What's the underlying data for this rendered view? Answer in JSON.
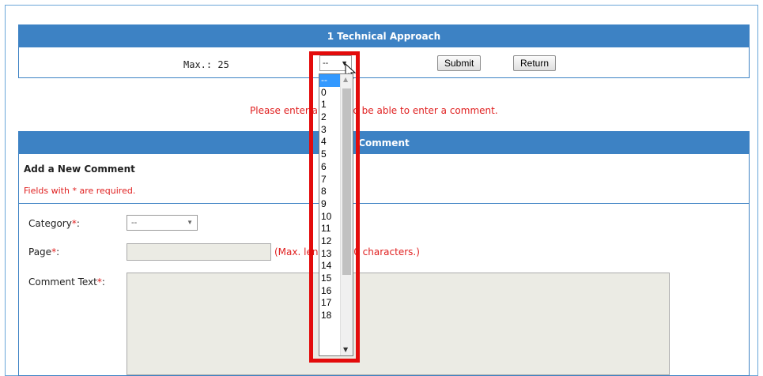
{
  "section": {
    "title": "1 Technical Approach",
    "max_label": "Max.: 25",
    "select_value": "--",
    "submit_label": "Submit",
    "return_label": "Return"
  },
  "message": {
    "text": "Please enter a score to be able to enter a comment."
  },
  "comment": {
    "header": "Comment",
    "title": "Add a New Comment",
    "required_note": "Fields with * are required.",
    "category_label": "Category",
    "category_value": "--",
    "page_label": "Page",
    "page_hint": "(Max. length is 50 characters.)",
    "text_label": "Comment Text",
    "required_mark": "*",
    "colon": ":"
  },
  "dropdown": {
    "options": [
      "--",
      "0",
      "1",
      "2",
      "3",
      "4",
      "5",
      "6",
      "7",
      "8",
      "9",
      "10",
      "11",
      "12",
      "13",
      "14",
      "15",
      "16",
      "17",
      "18"
    ],
    "selected_index": 0
  },
  "colors": {
    "header_blue": "#3d82c4",
    "highlight_red": "#e30b0b",
    "required_red": "#e02020"
  }
}
